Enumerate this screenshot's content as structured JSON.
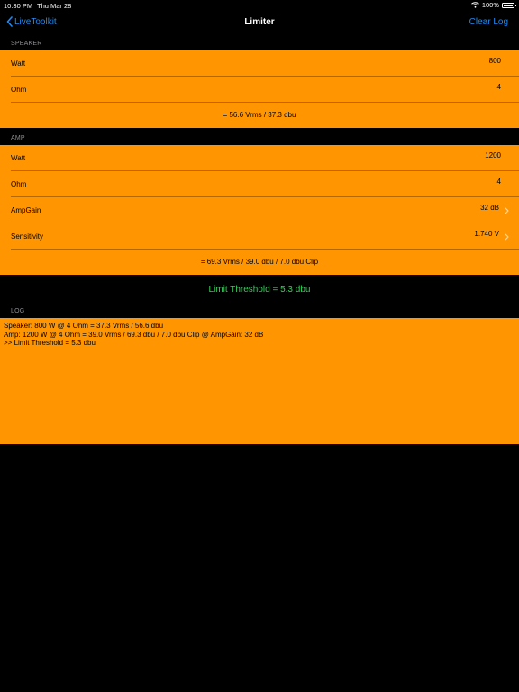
{
  "status_bar": {
    "time": "10:30 PM",
    "date": "Thu Mar 28",
    "battery": "100%",
    "wifi_icon": "wifi-icon",
    "battery_icon": "battery-icon"
  },
  "nav": {
    "back_label": "LiveToolkit",
    "title": "Limiter",
    "action_label": "Clear Log"
  },
  "speaker": {
    "header": "SPEAKER",
    "rows": [
      {
        "label": "Watt",
        "value": "800"
      },
      {
        "label": "Ohm",
        "value": "4"
      }
    ],
    "result": "= 56.6 Vrms / 37.3 dbu"
  },
  "amp": {
    "header": "AMP",
    "rows": [
      {
        "label": "Watt",
        "value": "1200"
      },
      {
        "label": "Ohm",
        "value": "4"
      },
      {
        "label": "AmpGain",
        "value": "32 dB"
      },
      {
        "label": "Sensitivity",
        "value": "1.740 V"
      }
    ],
    "result": "= 69.3 Vrms / 39.0 dbu / 7.0 dbu Clip"
  },
  "threshold": "Limit Threshold = 5.3 dbu",
  "log": {
    "header": "LOG",
    "lines": [
      "Speaker: 800 W @ 4 Ohm = 37.3 Vrms / 56.6 dbu",
      "Amp: 1200 W @ 4 Ohm = 39.0 Vrms / 69.3 dbu / 7.0 dbu Clip @ AmpGain: 32 dB",
      ">> Limit Threshold = 5.3 dbu"
    ]
  },
  "colors": {
    "accent": "#1e8bf6",
    "group_background": "#ff9500",
    "threshold_text": "#30d158",
    "header_text": "#8e8e93"
  }
}
